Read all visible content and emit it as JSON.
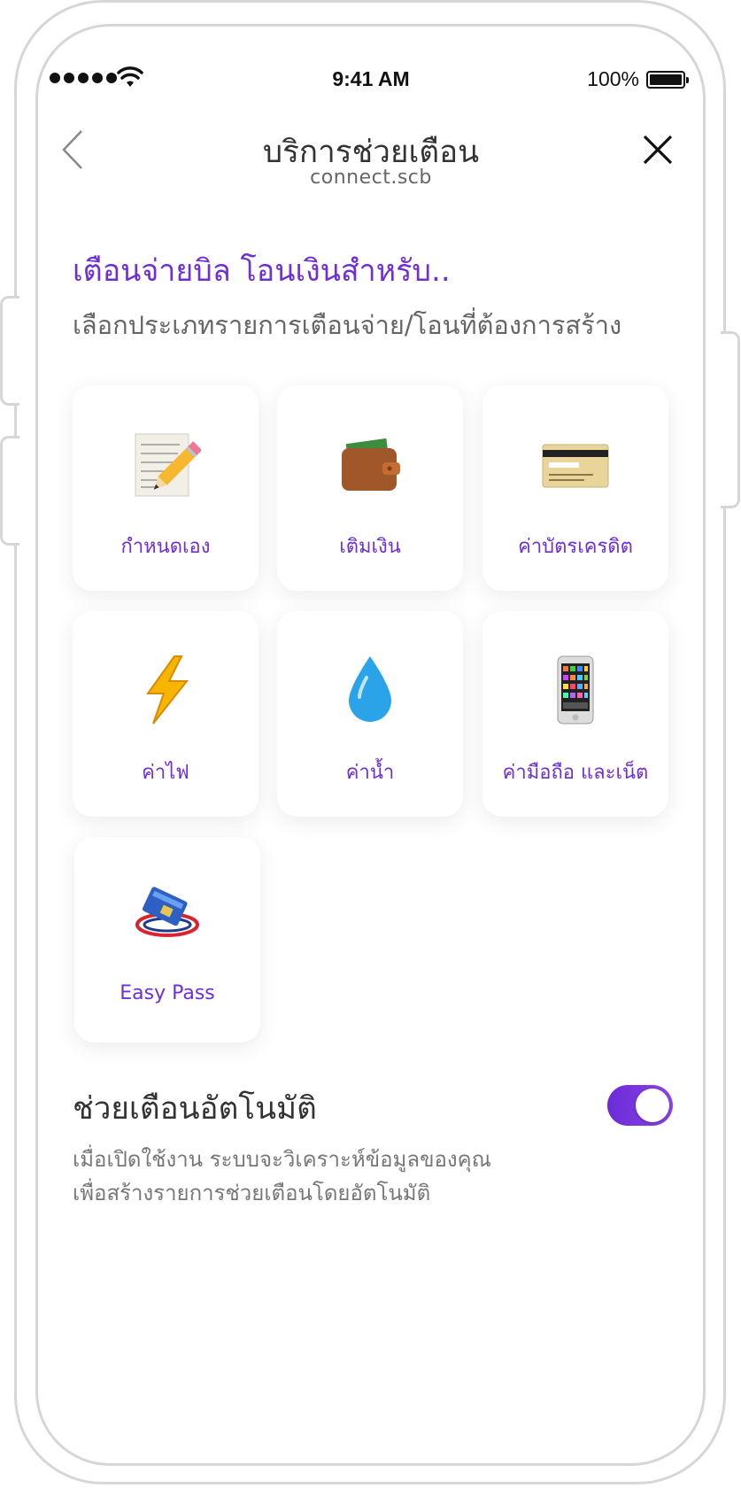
{
  "status_bar": {
    "time": "9:41 AM",
    "battery": "100%"
  },
  "nav": {
    "title": "บริการช่วยเตือน",
    "subtitle": "connect.scb"
  },
  "heading": "เตือนจ่ายบิล โอนเงินสำหรับ..",
  "subheading": "เลือกประเภทรายการเตือนจ่าย/โอนที่ต้องการสร้าง",
  "tiles": [
    {
      "label": "กำหนดเอง",
      "icon": "memo-pencil-icon"
    },
    {
      "label": "เติมเงิน",
      "icon": "wallet-icon"
    },
    {
      "label": "ค่าบัตรเครดิต",
      "icon": "credit-card-icon"
    },
    {
      "label": "ค่าไฟ",
      "icon": "lightning-icon"
    },
    {
      "label": "ค่าน้ำ",
      "icon": "water-drop-icon"
    },
    {
      "label": "ค่ามือถือ และเน็ต",
      "icon": "mobile-phone-icon"
    },
    {
      "label": "Easy Pass",
      "icon": "easy-pass-icon"
    }
  ],
  "auto_reminder": {
    "title": "ช่วยเตือนอัตโนมัติ",
    "description_line1": "เมื่อเปิดใช้งาน ระบบจะวิเคราะห์ข้อมูลของคุณ",
    "description_line2": "เพื่อสร้างรายการช่วยเตือนโดยอัตโนมัติ",
    "enabled": true
  },
  "colors": {
    "accent": "#6e2fd6",
    "toggle": "#7a36de"
  }
}
